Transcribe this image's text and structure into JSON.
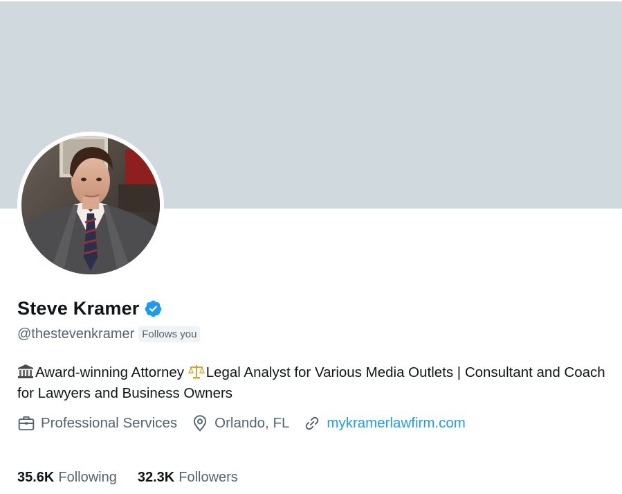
{
  "profile": {
    "display_name": "Steve Kramer",
    "handle": "@thestevenkramer",
    "follows_badge": "Follows you",
    "verified_icon": "verified-badge-icon",
    "bio": {
      "icon_1": "classical-building-icon",
      "part_1": "Award-winning Attorney ",
      "icon_2": "balance-scale-icon",
      "part_2": "Legal Analyst for Various Media Outlets |  Consultant and Coach for Lawyers and Business Owners"
    },
    "meta": {
      "category": "Professional Services",
      "location": "Orlando, FL",
      "website": "mykramerlawfirm.com"
    },
    "stats": {
      "following_count": "35.6K",
      "following_label": "Following",
      "followers_count": "32.3K",
      "followers_label": "Followers"
    }
  },
  "colors": {
    "banner": "#cfd9de",
    "link": "#1d9bf0",
    "verified": "#1d9bf0",
    "secondary_text": "#536471"
  }
}
